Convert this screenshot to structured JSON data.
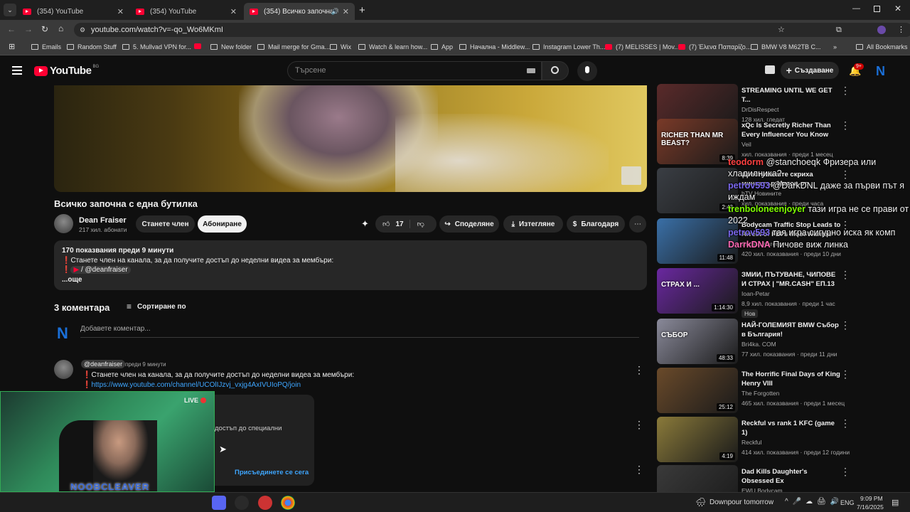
{
  "browser": {
    "tabs": [
      {
        "label": "(354) YouTube"
      },
      {
        "label": "(354) YouTube"
      },
      {
        "label": "(354) Всичко започна с една бутилка"
      }
    ],
    "url": "youtube.com/watch?v=-qo_Wo6MKmI",
    "bookmarks": [
      "Emails",
      "Random Stuff",
      "5. Mullvad VPN for...",
      "New folder",
      "Mail merge for Gma...",
      "Wix",
      "Watch & learn how...",
      "App",
      "Начална - Middlew...",
      "Instagram Lower Th...",
      "(7) MELISSES | Mov...",
      "(7) Έλενα Παπαρίζο...",
      "BMW V8 M62TB C..."
    ],
    "all_bookmarks": "All Bookmarks"
  },
  "youtube": {
    "logo": "YouTube",
    "region": "BG",
    "search_placeholder": "Търсене",
    "create_label": "Създаване",
    "notif_count": "9+",
    "avatar_letter": "N"
  },
  "video": {
    "title": "Всичко започна с една бутилка",
    "channel": "Dean Fraiser",
    "subscribers": "217 хил. абонати",
    "join_label": "Станете член",
    "subscribe_label": "Абониране",
    "likes": "17",
    "share_label": "Споделяне",
    "download_label": "Изтегляне",
    "thanks_label": "Благодаря",
    "desc_stats": "170 показвания  преди 9 минути",
    "desc_line1": "Станете член на канала, за да получите достъп до неделни видеа за мембъри:",
    "desc_handle": "/ @deanfraiser",
    "desc_more": "...още"
  },
  "comments": {
    "count_label": "3 коментара",
    "sort_label": "Сортиране по",
    "add_placeholder": "Добавете коментар...",
    "avatar_letter": "N",
    "items": [
      {
        "handle": "@deanfraiser",
        "time": "преди 9 минути",
        "line1": "Станете член на канала, за да получите достъп до неделни видеа за мембъри:",
        "link": "https://www.youtube.com/channel/UCOlIJzvj_vxjg4AxIVUIoPQ/join"
      }
    ],
    "partial_text": "достъп до специални",
    "join_cta": "Присъединете се сега"
  },
  "stream": {
    "live_label": "LIVE",
    "streamer": "NOOBCLEAVER",
    "chat": [
      {
        "user": "teodorm",
        "color": "#ff4040",
        "text": " @stanchoeqk Фризера или хладилника?"
      },
      {
        "user": "petrov593",
        "color": "#7b68ee",
        "text": " @DarkDNL даже за първи път я иждам"
      },
      {
        "user": "trenboloneenjoyer",
        "color": "#7fff00",
        "text": " тази игра не се прави от 2022"
      },
      {
        "user": "petrov593",
        "color": "#7b68ee",
        "text": " тая игра сигурно иска як комп"
      },
      {
        "user": "DarrkDNA",
        "color": "#ff69b4",
        "text": " Пичове виж линка"
      }
    ]
  },
  "sidebar": [
    {
      "title": "STREAMING UNTIL WE GET T...",
      "channel": "DrDisRespect",
      "meta": "128 хил. гледат",
      "badge": "НА ЖИВО",
      "duration": "",
      "thumb": "#5a2a2a"
    },
    {
      "title": "xQc Is Secretly Richer Than Every Influencer You Know",
      "channel": "Veil",
      "meta": "хил. показвания · преди 1 месец",
      "duration": "8:39",
      "thumb_text": "RICHER THAN MR BEAST?",
      "thumb": "#7a3a28"
    },
    {
      "title": "Арестуваните скриха министър Митов от...",
      "channel": "bTV Новините",
      "meta": "хил. показвания · преди часа",
      "duration": "2:43",
      "thumb": "#3a3e44"
    },
    {
      "title": "Bodycam Traffic Stop Leads to Arrest of FBI's Most Wanted",
      "channel": "Cops & Karens",
      "meta": "420 хил. показвания · преди 10 дни",
      "duration": "11:48",
      "thumb": "#3a70a8"
    },
    {
      "title": "ЗМИИ, ПЪТУВАНЕ, ЧИПОВЕ И СТРАХ | \"MR.CASH\" ЕП.13",
      "channel": "Ioan-Petar",
      "meta": "8,9 хил. показвания · преди 1 час",
      "tag": "Нов",
      "duration": "1:14:30",
      "thumb_text": "СТРАХ И ...",
      "thumb": "#6a28a0"
    },
    {
      "title": "НАЙ-ГОЛЕМИЯТ BMW Събор в България!",
      "channel": "Bri4ka. COM",
      "meta": "77 хил. показвания · преди 11 дни",
      "duration": "48:33",
      "thumb_text": "СЪБОР",
      "thumb": "#8a8a9a"
    },
    {
      "title": "The Horrific Final Days of King Henry VIII",
      "channel": "The Forgotten",
      "meta": "465 хил. показвания · преди 1 месец",
      "duration": "25:12",
      "thumb": "#6a4a2a"
    },
    {
      "title": "Reckful vs rank 1 KFC (game 1)",
      "channel": "Reckful",
      "meta": "414 хил. показвания · преди 12 години",
      "duration": "4:19",
      "thumb": "#8a7a3a"
    },
    {
      "title": "Dad Kills Daughter's Obsessed Ex",
      "channel": "EWU Bodycam",
      "meta": "",
      "duration": "",
      "thumb": "#3a3a3a"
    }
  ],
  "taskbar": {
    "weather": "Downpour tomorrow",
    "lang": "ENG",
    "time": "9:09 PM",
    "date": "7/16/2025"
  }
}
